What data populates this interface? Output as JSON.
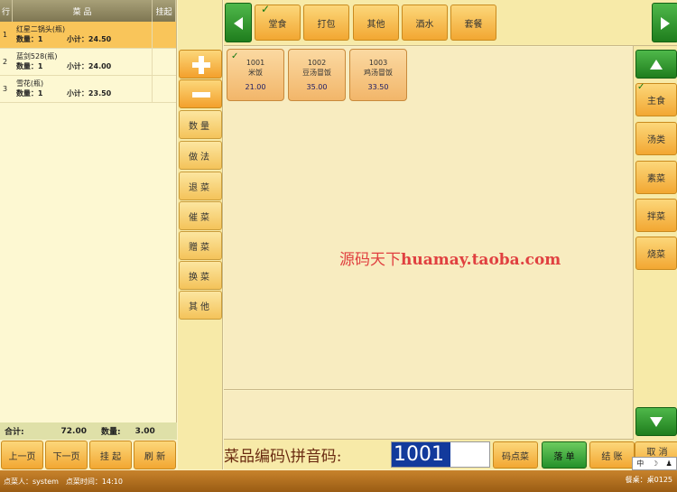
{
  "order_panel": {
    "headers": {
      "idx": "行",
      "name": "菜 品",
      "hold": "挂起"
    },
    "items": [
      {
        "idx": "1",
        "name": "红星二锅头(瓶)",
        "qty_label": "数量：1",
        "subtotal_label": "小计：24.50",
        "selected": true
      },
      {
        "idx": "2",
        "name": "蓝剑528(瓶)",
        "qty_label": "数量：1",
        "subtotal_label": "小计：24.00",
        "selected": false
      },
      {
        "idx": "3",
        "name": "雪花(瓶)",
        "qty_label": "数量：1",
        "subtotal_label": "小计：23.50",
        "selected": false
      }
    ],
    "footer": {
      "total_label": "合计:",
      "total_value": "72.00",
      "count_label": "数量:",
      "count_value": "3.00"
    }
  },
  "nav_buttons": {
    "prev": "上一页",
    "next": "下一页",
    "hold": "挂 起",
    "refresh": "刷 新"
  },
  "actions": {
    "quantity": "数量",
    "method": "做法",
    "return": "退菜",
    "urge": "催菜",
    "gift": "赠菜",
    "change": "换菜",
    "other": "其他"
  },
  "categories": [
    {
      "label": "堂食",
      "checked": true
    },
    {
      "label": "打包",
      "checked": false
    },
    {
      "label": "其他",
      "checked": false
    },
    {
      "label": "酒水",
      "checked": false
    },
    {
      "label": "套餐",
      "checked": false
    }
  ],
  "dishes": [
    {
      "code": "1001",
      "name": "米饭",
      "price": "21.00",
      "checked": true
    },
    {
      "code": "1002",
      "name": "豆汤冒饭",
      "price": "35.00",
      "checked": false
    },
    {
      "code": "1003",
      "name": "鸡汤冒饭",
      "price": "33.50",
      "checked": false
    }
  ],
  "watermark": {
    "cn": "源码天下",
    "en": "huamay.taoba.com"
  },
  "subcategories": [
    {
      "label": "主食",
      "checked": true
    },
    {
      "label": "汤类",
      "checked": false
    },
    {
      "label": "素菜",
      "checked": false
    },
    {
      "label": "拌菜",
      "checked": false
    },
    {
      "label": "烧菜",
      "checked": false
    }
  ],
  "input_bar": {
    "label": "菜品编码\\拼音码:",
    "value": "1001",
    "code_order": "码点菜",
    "send_order": "落 单",
    "checkout": "结 账",
    "cancel": "取 消"
  },
  "ime": {
    "mode": "中",
    "moon": "☽",
    "user": "♟"
  },
  "status_bar": {
    "user": "点菜人：system",
    "time": "点菜时间：14:10",
    "table": "餐桌：桌0125"
  },
  "colors": {
    "accent_orange": "#f2a732",
    "accent_green": "#1f7d1d",
    "selected_row": "#f9c55a",
    "background": "#fbf3c8"
  }
}
